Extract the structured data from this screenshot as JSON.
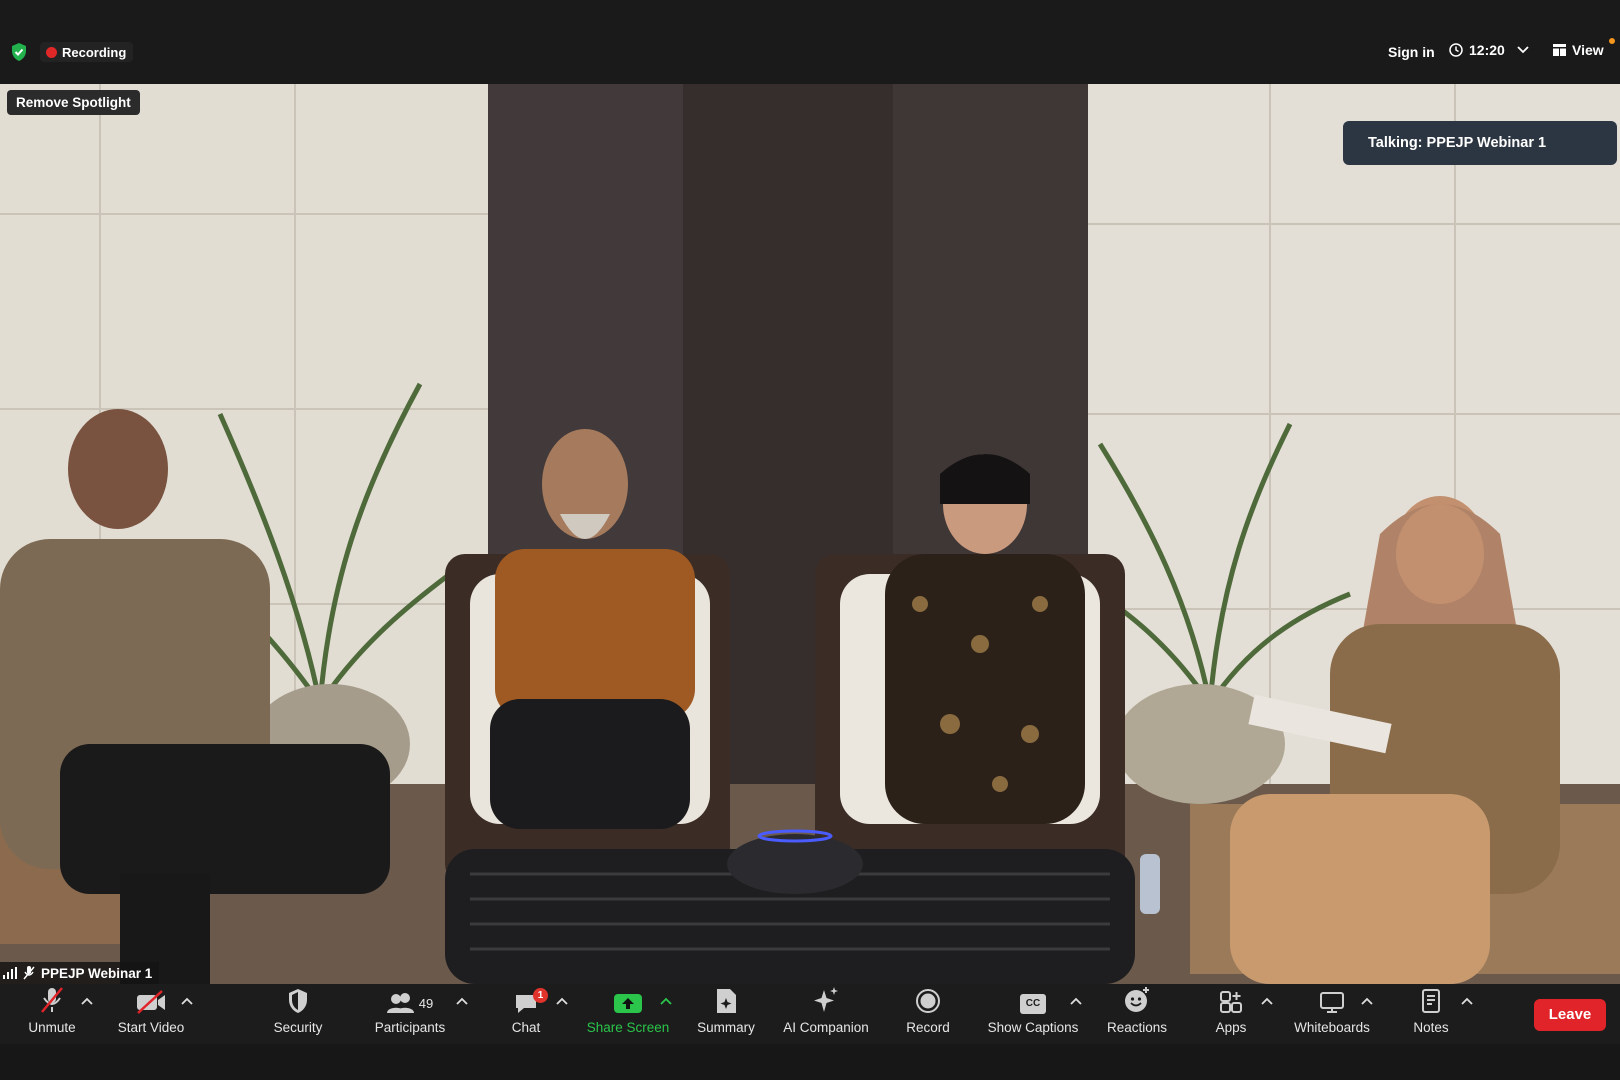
{
  "window": {
    "recording_label": "Recording",
    "sign_in": "Sign in",
    "time": "12:20",
    "view_label": "View"
  },
  "video": {
    "remove_spotlight": "Remove Spotlight",
    "talking_notice": "Talking: PPEJP Webinar 1",
    "participant_name": "PPEJP Webinar 1"
  },
  "toolbar": {
    "unmute": "Unmute",
    "start_video": "Start Video",
    "security": "Security",
    "participants": "Participants",
    "participants_count": "49",
    "chat": "Chat",
    "chat_badge": "1",
    "share_screen": "Share Screen",
    "summary": "Summary",
    "ai_companion": "AI Companion",
    "record": "Record",
    "show_captions": "Show Captions",
    "captions_icon_text": "CC",
    "reactions": "Reactions",
    "apps": "Apps",
    "whiteboards": "Whiteboards",
    "notes": "Notes",
    "leave": "Leave"
  },
  "colors": {
    "share_green": "#2ac54a",
    "leave_red": "#e0242a",
    "recording_red": "#e02828",
    "talking_bg": "#2c3642"
  },
  "icons": [
    "shield-check-icon",
    "clock-icon",
    "chevron-down-icon",
    "view-grid-icon",
    "mic-off-icon",
    "video-off-icon",
    "security-shield-icon",
    "participants-icon",
    "chat-bubble-icon",
    "share-arrow-icon",
    "summary-doc-icon",
    "sparkle-icon",
    "record-icon",
    "cc-icon",
    "reaction-smile-icon",
    "apps-icon",
    "whiteboard-icon",
    "notes-icon",
    "signal-bars-icon"
  ]
}
